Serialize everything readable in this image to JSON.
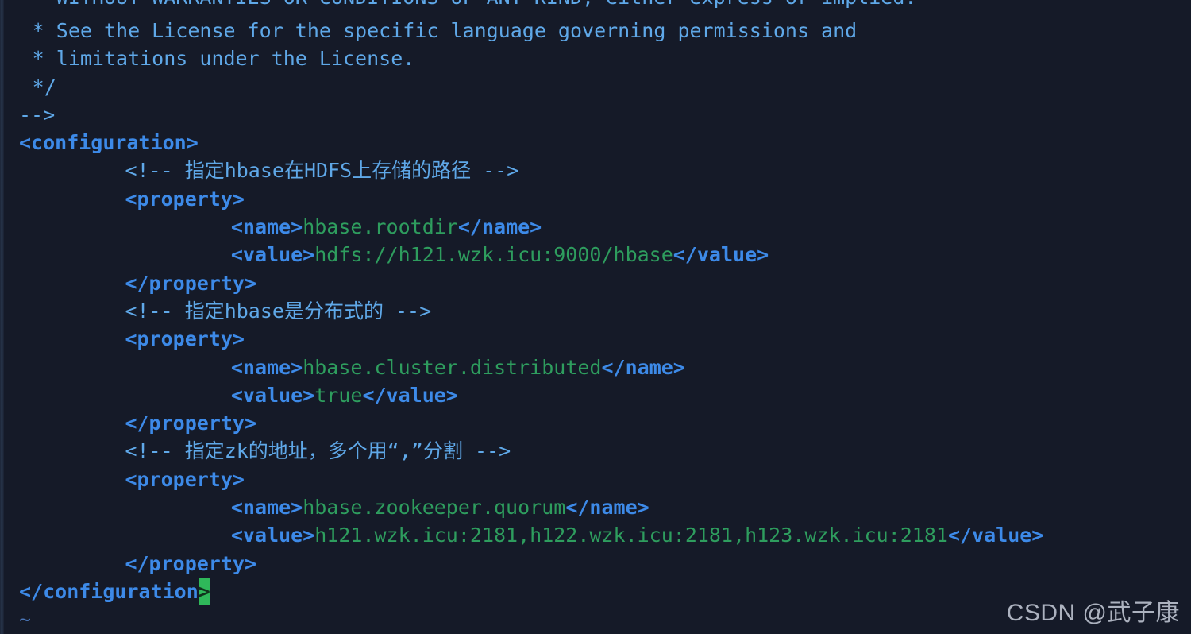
{
  "terminal": {
    "background_color": "#151a28",
    "editor": "vim",
    "file_type": "xml"
  },
  "colors": {
    "comment": "#5fa8e8",
    "tag": "#3d8ae8",
    "text_content": "#2e9d5e",
    "cursor_block": "#2fb85a",
    "tilde": "#4a76b8",
    "watermark": "#b9bfcc"
  },
  "code": {
    "lines": [
      {
        "indent": 1,
        "clipped": true,
        "parts": [
          {
            "kind": "cmt",
            "text": "* WITHOUT WARRANTIES OR CONDITIONS OF ANY KIND, either express or implied."
          }
        ]
      },
      {
        "indent": 1,
        "parts": [
          {
            "kind": "cmt",
            "text": "* See the License for the specific language governing permissions and"
          }
        ]
      },
      {
        "indent": 1,
        "parts": [
          {
            "kind": "cmt",
            "text": "* limitations under the License."
          }
        ]
      },
      {
        "indent": 1,
        "parts": [
          {
            "kind": "cmt",
            "text": "*/"
          }
        ]
      },
      {
        "indent": 0,
        "parts": [
          {
            "kind": "cmt",
            "text": "-->"
          }
        ]
      },
      {
        "indent": 0,
        "parts": [
          {
            "kind": "tag",
            "text": "<configuration>"
          }
        ]
      },
      {
        "indent": 8,
        "parts": [
          {
            "kind": "cmt",
            "text": "<!-- 指定hbase在HDFS上存储的路径 -->"
          }
        ]
      },
      {
        "indent": 8,
        "parts": [
          {
            "kind": "tag",
            "text": "<property>"
          }
        ]
      },
      {
        "indent": 16,
        "parts": [
          {
            "kind": "tag",
            "text": "<name>"
          },
          {
            "kind": "txt",
            "text": "hbase.rootdir"
          },
          {
            "kind": "tag",
            "text": "</name>"
          }
        ]
      },
      {
        "indent": 16,
        "parts": [
          {
            "kind": "tag",
            "text": "<value>"
          },
          {
            "kind": "txt",
            "text": "hdfs://h121.wzk.icu:9000/hbase"
          },
          {
            "kind": "tag",
            "text": "</value>"
          }
        ]
      },
      {
        "indent": 8,
        "parts": [
          {
            "kind": "tag",
            "text": "</property>"
          }
        ]
      },
      {
        "indent": 8,
        "parts": [
          {
            "kind": "cmt",
            "text": "<!-- 指定hbase是分布式的 -->"
          }
        ]
      },
      {
        "indent": 8,
        "parts": [
          {
            "kind": "tag",
            "text": "<property>"
          }
        ]
      },
      {
        "indent": 16,
        "parts": [
          {
            "kind": "tag",
            "text": "<name>"
          },
          {
            "kind": "txt",
            "text": "hbase.cluster.distributed"
          },
          {
            "kind": "tag",
            "text": "</name>"
          }
        ]
      },
      {
        "indent": 16,
        "parts": [
          {
            "kind": "tag",
            "text": "<value>"
          },
          {
            "kind": "txt",
            "text": "true"
          },
          {
            "kind": "tag",
            "text": "</value>"
          }
        ]
      },
      {
        "indent": 8,
        "parts": [
          {
            "kind": "tag",
            "text": "</property>"
          }
        ]
      },
      {
        "indent": 8,
        "parts": [
          {
            "kind": "cmt",
            "text": "<!-- 指定zk的地址，多个用“,”分割 -->"
          }
        ]
      },
      {
        "indent": 8,
        "parts": [
          {
            "kind": "tag",
            "text": "<property>"
          }
        ]
      },
      {
        "indent": 16,
        "parts": [
          {
            "kind": "tag",
            "text": "<name>"
          },
          {
            "kind": "txt",
            "text": "hbase.zookeeper.quorum"
          },
          {
            "kind": "tag",
            "text": "</name>"
          }
        ]
      },
      {
        "indent": 16,
        "parts": [
          {
            "kind": "tag",
            "text": "<value>"
          },
          {
            "kind": "txt",
            "text": "h121.wzk.icu:2181,h122.wzk.icu:2181,h123.wzk.icu:2181"
          },
          {
            "kind": "tag",
            "text": "</value>"
          }
        ]
      },
      {
        "indent": 8,
        "parts": [
          {
            "kind": "tag",
            "text": "</property>"
          }
        ]
      },
      {
        "indent": 0,
        "parts": [
          {
            "kind": "tag",
            "text": "</configuration"
          },
          {
            "kind": "cursor",
            "text": ">"
          }
        ]
      },
      {
        "indent": 0,
        "parts": [
          {
            "kind": "tilde",
            "text": "~"
          }
        ]
      }
    ]
  },
  "watermark": {
    "text": "CSDN @武子康"
  }
}
